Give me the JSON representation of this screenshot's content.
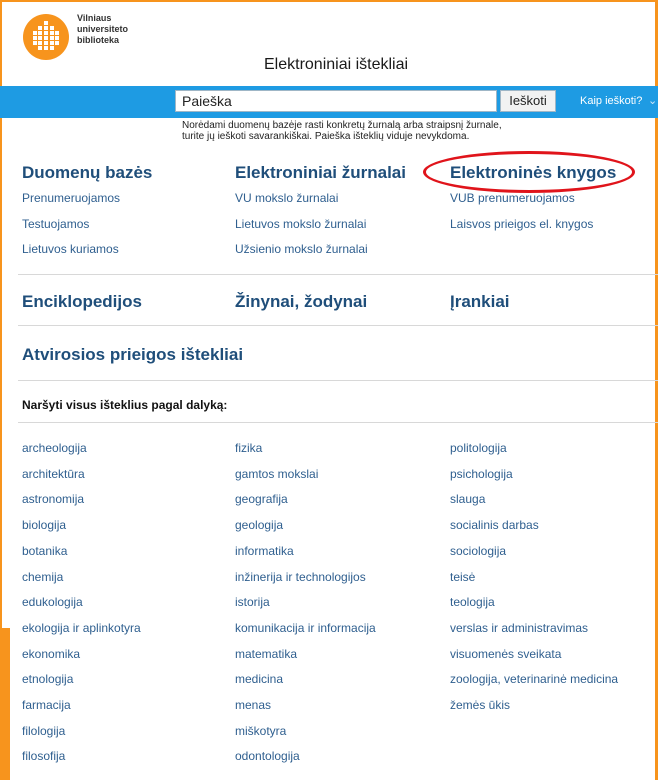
{
  "header": {
    "logo_lines": [
      "Vilniaus",
      "universiteto",
      "biblioteka"
    ],
    "title": "Elektroniniai ištekliai"
  },
  "search": {
    "value": "Paieška",
    "button_label": "Ieškoti",
    "help_label": "Kaip ieškoti?",
    "note_lines": [
      "Norėdami duomenų bazėje rasti konkretų žurnalą arba straipsnį žurnale,",
      "turite jų ieškoti savarankiškai. Paieška išteklių viduje nevykdoma."
    ]
  },
  "columns": [
    {
      "heading": "Duomenų bazės",
      "links": [
        "Prenumeruojamos",
        "Testuojamos",
        "Lietuvos kuriamos"
      ]
    },
    {
      "heading": "Elektroniniai žurnalai",
      "links": [
        "VU mokslo žurnalai",
        "Lietuvos mokslo žurnalai",
        "Užsienio mokslo žurnalai"
      ]
    },
    {
      "heading": "Elektroninės knygos",
      "links": [
        "VUB prenumeruojamos",
        "Laisvos prieigos el. knygos"
      ]
    }
  ],
  "row2": [
    "Enciklopedijos",
    "Žinynai, žodynai",
    "Įrankiai"
  ],
  "open_access": "Atvirosios prieigos ištekliai",
  "browse_label": "Naršyti visus išteklius pagal dalyką:",
  "subjects": {
    "col1": [
      "archeologija",
      "architektūra",
      "astronomija",
      "biologija",
      "botanika",
      "chemija",
      "edukologija",
      "ekologija ir aplinkotyra",
      "ekonomika",
      "etnologija",
      "farmacija",
      "filologija",
      "filosofija"
    ],
    "col2": [
      "fizika",
      "gamtos mokslai",
      "geografija",
      "geologija",
      "informatika",
      "inžinerija ir technologijos",
      "istorija",
      "komunikacija ir informacija",
      "matematika",
      "medicina",
      "menas",
      "miškotyra",
      "odontologija"
    ],
    "col3": [
      "politologija",
      "psichologija",
      "slauga",
      "socialinis darbas",
      "sociologija",
      "teisė",
      "teologija",
      "verslas ir administravimas",
      "visuomenės sveikata",
      "zoologija, veterinarinė medicina",
      "žemės ūkis"
    ]
  },
  "colors": {
    "accent_orange": "#f7941d",
    "search_blue": "#1e9be3",
    "heading_blue": "#1f4e7a",
    "link_blue": "#2f5f8f",
    "annotation_red": "#e0141b"
  }
}
